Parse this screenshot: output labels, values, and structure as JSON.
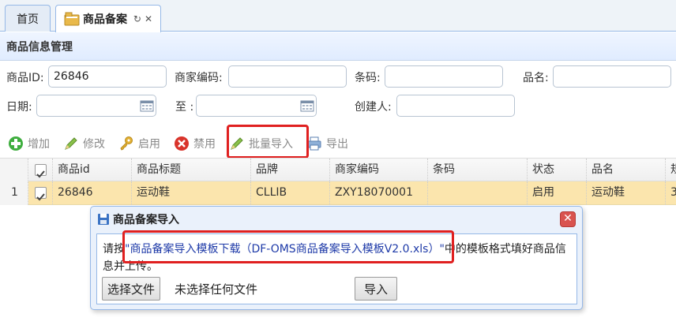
{
  "tabs": [
    {
      "label": "首页"
    },
    {
      "label": "商品备案"
    }
  ],
  "panel": {
    "title": "商品信息管理"
  },
  "search": {
    "product_id_label": "商品ID:",
    "product_id_value": "26846",
    "merchant_code_label": "商家编码:",
    "barcode_label": "条码:",
    "name_label": "品名:",
    "date_label": "日期:",
    "to_label": "至 :",
    "creator_label": "创建人:"
  },
  "toolbar": {
    "add": "增加",
    "edit": "修改",
    "enable": "启用",
    "disable": "禁用",
    "batch_import": "批量导入",
    "export": "导出"
  },
  "grid": {
    "columns": [
      "商品id",
      "商品标题",
      "品牌",
      "商家编码",
      "条码",
      "状态",
      "品名",
      "规"
    ],
    "rows": [
      {
        "num": "1",
        "id": "26846",
        "title": "运动鞋",
        "brand": "CLLIB",
        "merchant_code": "ZXY18070001",
        "barcode": "",
        "status": "启用",
        "name": "运动鞋",
        "extra": "3"
      }
    ]
  },
  "dialog": {
    "title": "商品备案导入",
    "instr_prefix": "请按",
    "instr_link": "\"商品备案导入模板下载（DF-OMS商品备案导入模板V2.0.xls）\"",
    "instr_suffix": "中的模板格式填好商品信息并上传。",
    "choose_file": "选择文件",
    "no_file": "未选择任何文件",
    "import": "导入"
  },
  "colors": {
    "accent_border": "#95b8e7",
    "selected_row": "#fbe5ad",
    "highlight": "#e02020",
    "link": "#1e3aa8"
  }
}
